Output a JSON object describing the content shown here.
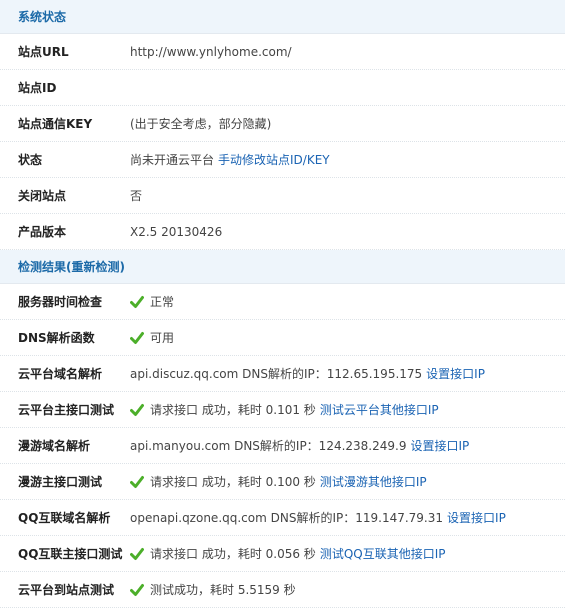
{
  "status_section": {
    "title": "系统状态",
    "rows": [
      {
        "label": "站点URL",
        "value": "http://www.ynlyhome.com/"
      },
      {
        "label": "站点ID",
        "value": ""
      },
      {
        "label": "站点通信KEY",
        "value": "(出于安全考虑，部分隐藏)"
      },
      {
        "label": "状态",
        "value": "尚未开通云平台",
        "link": "手动修改站点ID/KEY"
      },
      {
        "label": "关闭站点",
        "value": "否"
      },
      {
        "label": "产品版本",
        "value": "X2.5 20130426"
      }
    ]
  },
  "check_section": {
    "title": "检测结果",
    "recheck": "(重新检测)",
    "rows": [
      {
        "label": "服务器时间检查",
        "value": "正常"
      },
      {
        "label": "DNS解析函数",
        "value": "可用"
      },
      {
        "label": "云平台域名解析",
        "value": "api.discuz.qq.com DNS解析的IP：112.65.195.175",
        "link": "设置接口IP"
      },
      {
        "label": "云平台主接口测试",
        "value": "请求接口 成功，耗时 0.101 秒",
        "link": "测试云平台其他接口IP"
      },
      {
        "label": "漫游域名解析",
        "value": "api.manyou.com DNS解析的IP：124.238.249.9",
        "link": "设置接口IP"
      },
      {
        "label": "漫游主接口测试",
        "value": "请求接口 成功，耗时 0.100 秒",
        "link": "测试漫游其他接口IP"
      },
      {
        "label": "QQ互联域名解析",
        "value": "openapi.qzone.qq.com DNS解析的IP：119.147.79.31",
        "link": "设置接口IP"
      },
      {
        "label": "QQ互联主接口测试",
        "value": "请求接口 成功，耗时 0.056 秒",
        "link": "测试QQ互联其他接口IP"
      },
      {
        "label": "云平台到站点测试",
        "value": "测试成功，耗时 5.5159 秒"
      }
    ]
  },
  "colors": {
    "header_bg": "#eef5fb",
    "header_text": "#1c6aa8",
    "link": "#1a63b3",
    "check": "#4caf2a"
  },
  "icons": {
    "check": "check-icon"
  }
}
